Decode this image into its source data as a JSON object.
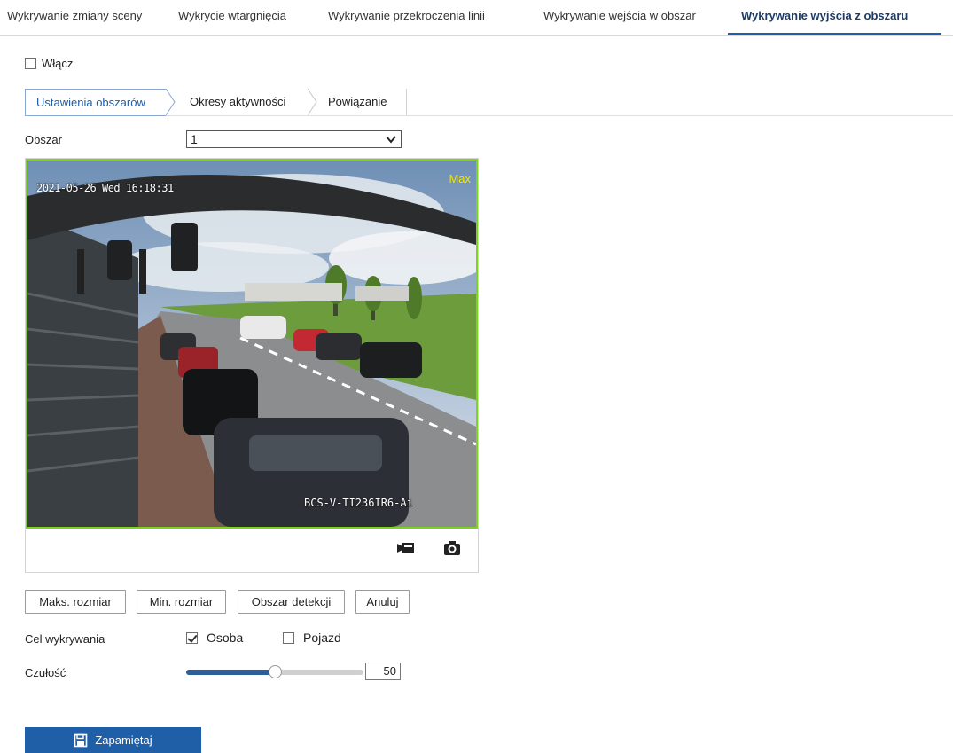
{
  "top_tabs": [
    {
      "label": "Wykrywanie zmiany sceny",
      "active": false
    },
    {
      "label": "Wykrycie wtargnięcia",
      "active": false
    },
    {
      "label": "Wykrywanie przekroczenia linii",
      "active": false
    },
    {
      "label": "Wykrywanie wejścia w obszar",
      "active": false
    },
    {
      "label": "Wykrywanie wyjścia z obszaru",
      "active": true
    }
  ],
  "enable": {
    "label": "Włącz",
    "checked": false
  },
  "sub_tabs": [
    {
      "label": "Ustawienia obszarów",
      "active": true
    },
    {
      "label": "Okresy aktywności",
      "active": false
    },
    {
      "label": "Powiązanie",
      "active": false
    }
  ],
  "area": {
    "label": "Obszar",
    "selected": "1"
  },
  "video": {
    "timestamp": "2021-05-26 Wed 16:18:31",
    "max_label": "Max",
    "camera_name": "BCS-V-TI236IR6-Ai",
    "border_color": "#7ed321",
    "tools": [
      "record-icon",
      "camera-icon"
    ]
  },
  "buttons": {
    "max_size": "Maks. rozmiar",
    "min_size": "Min. rozmiar",
    "detection_area": "Obszar detekcji",
    "cancel": "Anuluj"
  },
  "target": {
    "label": "Cel wykrywania",
    "options": [
      {
        "label": "Osoba",
        "checked": true
      },
      {
        "label": "Pojazd",
        "checked": false
      }
    ]
  },
  "sensitivity": {
    "label": "Czułość",
    "value": "50",
    "fraction": 0.5
  },
  "save": {
    "label": "Zapamiętaj",
    "icon": "save-icon"
  },
  "colors": {
    "accent": "#1f5fa8",
    "active_tab_text": "#1d3b66",
    "slider_fill": "#2f5f99",
    "osd_max": "#f2e600"
  }
}
